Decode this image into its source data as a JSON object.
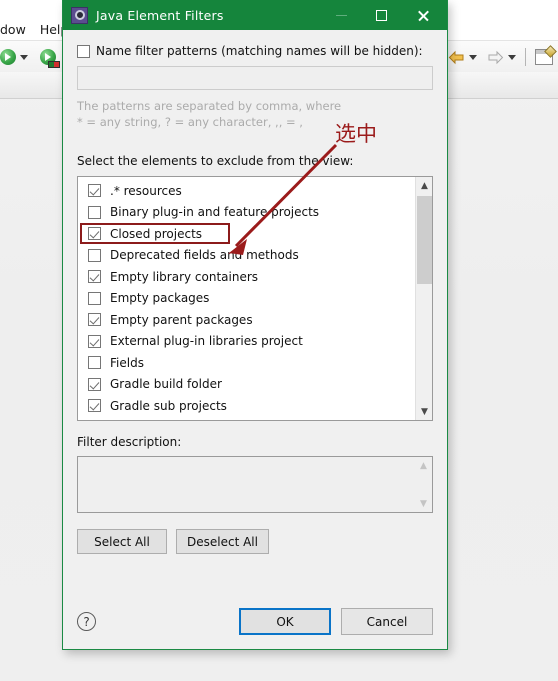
{
  "background": {
    "menu_items": [
      "dow",
      "Help"
    ],
    "toolbar": {
      "run_icon": "run-icon",
      "debug_icon": "debug-run-icon",
      "back_icon": "back-arrow-icon",
      "forward_icon": "forward-arrow-icon",
      "new_editor_icon": "new-editor-icon",
      "dropdown_icon": "chevron-down-icon"
    }
  },
  "dialog": {
    "title": "Java Element Filters",
    "icon": "java-filter-gear-icon",
    "window_controls": {
      "minimize": "minimize-icon",
      "maximize": "maximize-icon",
      "close": "close-icon"
    },
    "name_filter": {
      "label": "Name filter patterns (matching names will be hidden):",
      "checked": false,
      "input_value": "",
      "input_placeholder": "",
      "help_line1": "The patterns are separated by comma, where",
      "help_line2": "* = any string, ? = any character, ,, = ,"
    },
    "exclude_label": "Select the elements to exclude from the view:",
    "elements": [
      {
        "label": ".* resources",
        "checked": true,
        "highlighted": false
      },
      {
        "label": "Binary plug-in and feature projects",
        "checked": false,
        "highlighted": false
      },
      {
        "label": "Closed projects",
        "checked": true,
        "highlighted": true
      },
      {
        "label": "Deprecated fields and methods",
        "checked": false,
        "highlighted": false
      },
      {
        "label": "Empty library containers",
        "checked": true,
        "highlighted": false
      },
      {
        "label": "Empty packages",
        "checked": false,
        "highlighted": false
      },
      {
        "label": "Empty parent packages",
        "checked": true,
        "highlighted": false
      },
      {
        "label": "External plug-in libraries project",
        "checked": true,
        "highlighted": false
      },
      {
        "label": "Fields",
        "checked": false,
        "highlighted": false
      },
      {
        "label": "Gradle build folder",
        "checked": true,
        "highlighted": false
      },
      {
        "label": "Gradle sub projects",
        "checked": true,
        "highlighted": false
      }
    ],
    "list_scrollbar": {
      "up_arrow": "scroll-up-icon",
      "down_arrow": "scroll-down-icon"
    },
    "filter_description": {
      "label": "Filter description:",
      "value": ""
    },
    "select_buttons": {
      "select_all": "Select All",
      "deselect_all": "Deselect All"
    },
    "bottom": {
      "help": "?",
      "ok": "OK",
      "cancel": "Cancel"
    }
  },
  "annotation": {
    "text": "选中",
    "color": "#9b1b1b",
    "arrow": "annotation-arrow"
  },
  "colors": {
    "titlebar_green": "#15853c",
    "annotation_red": "#9b1b1b",
    "focus_blue": "#0a74c8",
    "dialog_bg": "#f0f0f0"
  }
}
